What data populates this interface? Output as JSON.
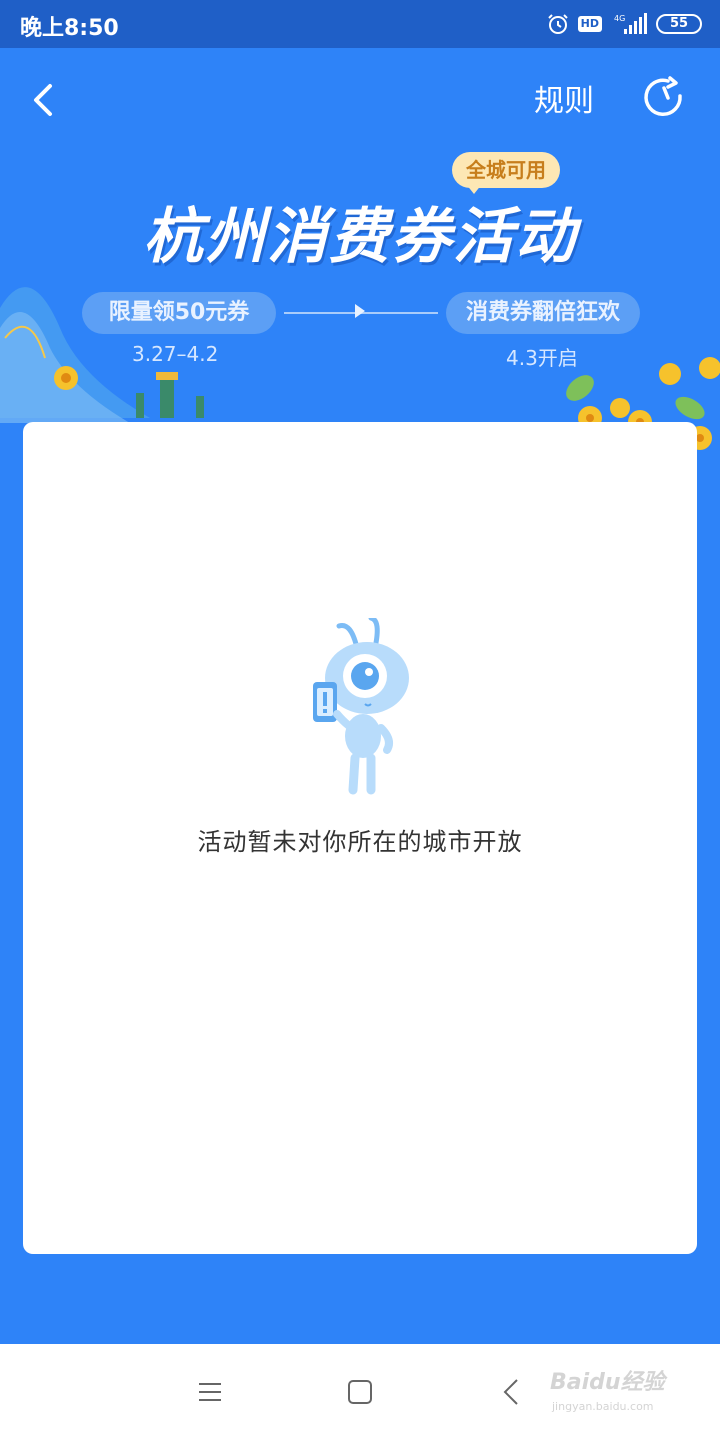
{
  "status_bar": {
    "time": "晚上8:50",
    "hd_label": "HD",
    "network_label": "4G",
    "battery_level": "55"
  },
  "header": {
    "rules_label": "规则"
  },
  "banner": {
    "tag": "全城可用",
    "title": "杭州消费券活动",
    "step1_label": "限量领50元券",
    "step1_date": "3.27–4.2",
    "step2_label": "消费券翻倍狂欢",
    "step2_date": "4.3开启"
  },
  "card": {
    "message": "活动暂未对你所在的城市开放"
  },
  "watermark": {
    "brand": "Baidu经验",
    "url": "jingyan.baidu.com"
  },
  "colors": {
    "primary_blue": "#2e83f8",
    "status_blue": "#1f5fc7",
    "tag_bg": "#fde7b4",
    "tag_text": "#c77e1c"
  }
}
